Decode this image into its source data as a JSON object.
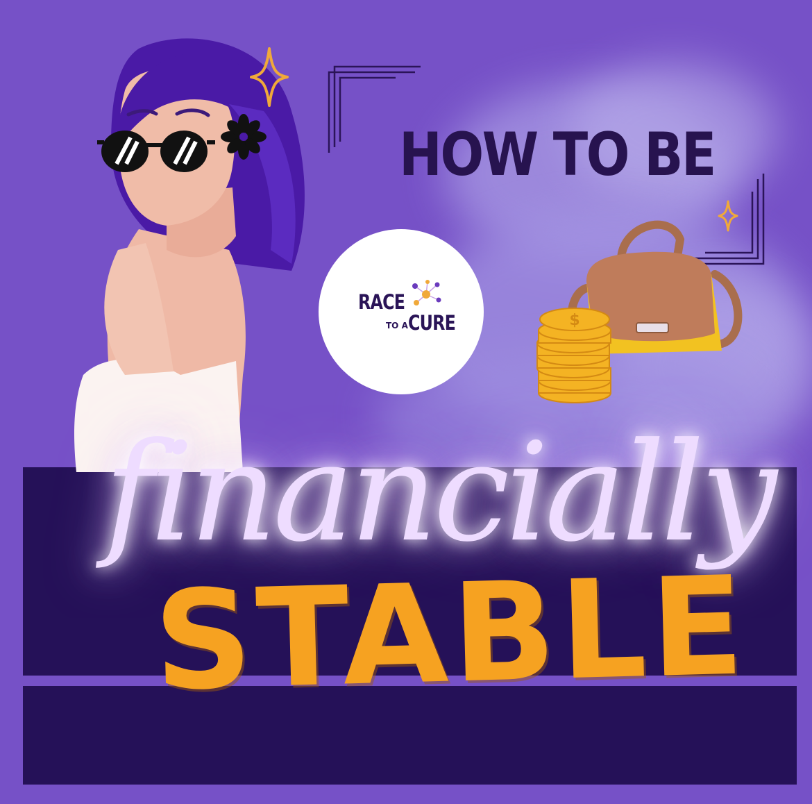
{
  "headline": "HOW TO BE",
  "script_word": "financially",
  "stable_word": "STABLE",
  "logo": {
    "line1": "RACE",
    "line2_small": "TO A",
    "line2_big": "CURE"
  },
  "icons": [
    "woman-illustration-icon",
    "sunglasses-icon",
    "flower-icon",
    "sparkle-icon",
    "handbag-icon",
    "coin-stack-icon",
    "dollar-sign-icon",
    "molecule-icon"
  ],
  "colors": {
    "background": "#7651c7",
    "band": "#251158",
    "headline": "#27134f",
    "script": "#eedcff",
    "stable": "#f6a221",
    "hair": "#4a1aa6",
    "skin": "#efb9a6",
    "bag": "#f2c221",
    "bag_flap": "#bf7c5b",
    "coin": "#f4b323"
  }
}
